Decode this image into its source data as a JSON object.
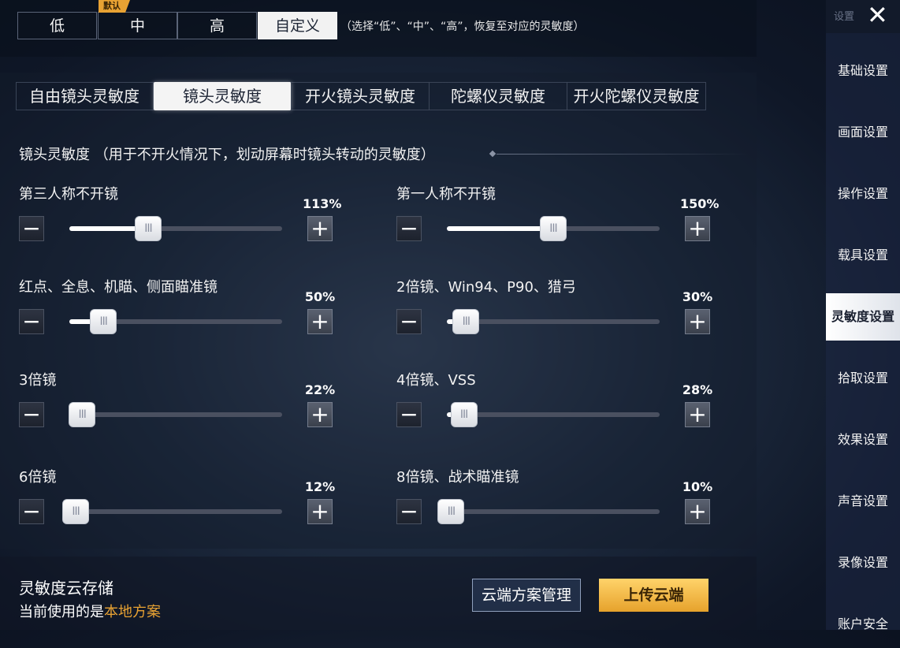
{
  "presets": {
    "options": [
      "低",
      "中",
      "高",
      "自定义"
    ],
    "default_badge": "默认",
    "hint": "（选择“低”、“中”、“高”，恢复至对应的灵敏度）"
  },
  "tabs": [
    "自由镜头灵敏度",
    "镜头灵敏度",
    "开火镜头灵敏度",
    "陀螺仪灵敏度",
    "开火陀螺仪灵敏度"
  ],
  "active_tab": "镜头灵敏度",
  "section_title": "镜头灵敏度   （用于不开火情况下，划动屏幕时镜头转动的灵敏度）",
  "sliders": [
    {
      "label": "第三人称不开镜",
      "percent": "113%",
      "value": 0.37
    },
    {
      "label": "第一人称不开镜",
      "percent": "150%",
      "value": 0.5
    },
    {
      "label": "红点、全息、机瞄、侧面瞄准镜",
      "percent": "50%",
      "value": 0.16
    },
    {
      "label": "2倍镜、Win94、P90、猎弓",
      "percent": "30%",
      "value": 0.09
    },
    {
      "label": "3倍镜",
      "percent": "22%",
      "value": 0.06
    },
    {
      "label": "4倍镜、VSS",
      "percent": "28%",
      "value": 0.08
    },
    {
      "label": "6倍镜",
      "percent": "12%",
      "value": 0.03
    },
    {
      "label": "8倍镜、战术瞄准镜",
      "percent": "10%",
      "value": 0.02
    }
  ],
  "knob_glyph": "III",
  "minus_glyph": "−",
  "plus_glyph": "+",
  "cloud": {
    "title": "灵敏度云存储",
    "current_prefix": "当前使用的是",
    "current_value": "本地方案",
    "manage_button": "云端方案管理",
    "upload_button": "上传云端"
  },
  "sidebar": {
    "header": "设置",
    "close_glyph": "✕",
    "items": [
      "基础设置",
      "画面设置",
      "操作设置",
      "载具设置",
      "灵敏度设置",
      "拾取设置",
      "效果设置",
      "声音设置",
      "录像设置",
      "账户安全"
    ],
    "active": "灵敏度设置"
  },
  "colors": {
    "accent": "#e8a233",
    "active_bg": "#f4f4f4"
  }
}
